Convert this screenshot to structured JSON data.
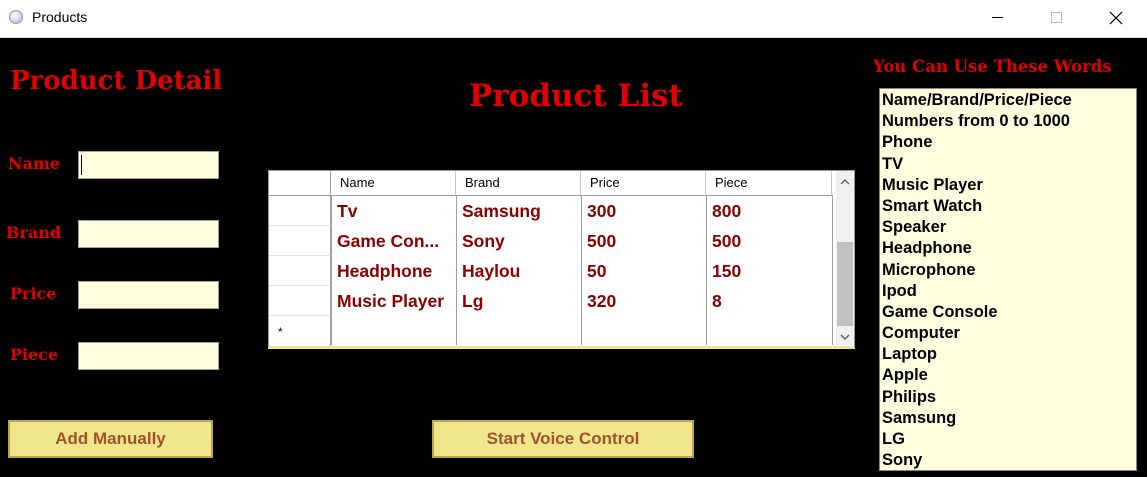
{
  "window": {
    "title": "Products"
  },
  "detail": {
    "heading": "Product Detail",
    "labels": {
      "name": "Name",
      "brand": "Brand",
      "price": "Price",
      "piece": "Piece"
    },
    "values": {
      "name": "",
      "brand": "",
      "price": "",
      "piece": ""
    },
    "add_button": "Add Manually"
  },
  "list": {
    "heading": "Product List",
    "columns": [
      "Name",
      "Brand",
      "Price",
      "Piece"
    ],
    "rows": [
      [
        "Tv",
        "Samsung",
        "300",
        "800"
      ],
      [
        "Game Con...",
        "Sony",
        "500",
        "500"
      ],
      [
        "Headphone",
        "Haylou",
        "50",
        "150"
      ],
      [
        "Music Player",
        "Lg",
        "320",
        "8"
      ]
    ],
    "new_row_marker": "*"
  },
  "voice": {
    "button": "Start Voice Control"
  },
  "words": {
    "heading": "You Can Use These Words",
    "items": [
      "Name/Brand/Price/Piece",
      "Numbers from 0 to 1000",
      "Phone",
      "TV",
      "Music Player",
      "Smart Watch",
      "Speaker",
      "Headphone",
      "Microphone",
      "Ipod",
      "Game Console",
      "Computer",
      "Laptop",
      "Apple",
      "Philips",
      "Samsung",
      "LG",
      "Sony"
    ]
  },
  "colors": {
    "heading_red": "#e00000",
    "cell_text": "#8b0000",
    "field_bg": "#ffffe0",
    "button_bg": "#f0e68c",
    "button_text": "#a0522d",
    "background": "#000000"
  }
}
